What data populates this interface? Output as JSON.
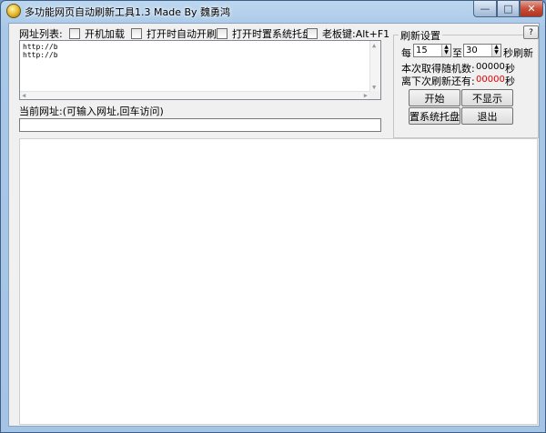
{
  "window": {
    "title": "多功能网页自动刷新工具1.3 Made By 魏勇鸿",
    "controls": {
      "min": "—",
      "max": "□",
      "close": "✕"
    }
  },
  "url_list": {
    "label": "网址列表:",
    "lines": [
      "http://b",
      "http://b"
    ]
  },
  "options": [
    {
      "label": "开机加载",
      "checked": false
    },
    {
      "label": "打开时自动开刷",
      "checked": false
    },
    {
      "label": "打开时置系统托盘",
      "checked": false
    },
    {
      "label": "老板键:Alt+F1",
      "checked": false
    }
  ],
  "address": {
    "label": "当前网址:(可输入网址,回车访问)",
    "value": ""
  },
  "refresh": {
    "group_title": "刷新设置",
    "help": "?",
    "each_label": "每",
    "min_value": "15",
    "to_label": "至",
    "max_value": "30",
    "unit_label": "秒刷新",
    "random_label": "本次取得随机数:",
    "random_value": "00000",
    "random_unit": "秒",
    "next_label": "离下次刷新还有:",
    "next_value": "00000",
    "next_unit": "秒",
    "accent_color": "#e00000"
  },
  "buttons": {
    "start": "开始",
    "hide": "不显示",
    "tray": "置系统托盘",
    "exit": "退出"
  }
}
